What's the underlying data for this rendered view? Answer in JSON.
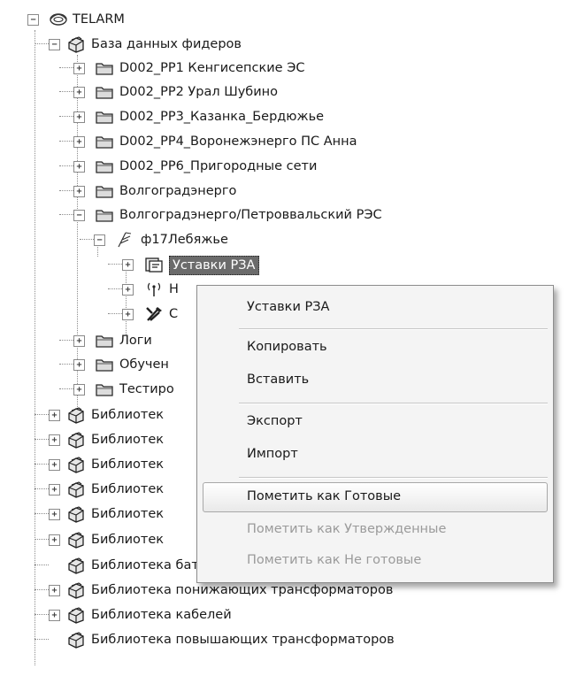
{
  "tree": {
    "root": {
      "label": "TELARM",
      "icon": "telarm-logo-icon",
      "expanded": true
    },
    "items": [
      {
        "label": "База данных фидеров",
        "icon": "database-icon",
        "expanded": true
      },
      {
        "label": "D002_PP1 Кенгисепские ЭС",
        "icon": "folder-icon",
        "expanded": false
      },
      {
        "label": "D002_PP2 Урал  Шубино",
        "icon": "folder-icon",
        "expanded": false
      },
      {
        "label": "D002_PP3_Казанка_Бердюжье",
        "icon": "folder-icon",
        "expanded": false
      },
      {
        "label": "D002_PP4_Воронежэнерго ПС Анна",
        "icon": "folder-icon",
        "expanded": false
      },
      {
        "label": "D002_PP6_Пригородные сети",
        "icon": "folder-icon",
        "expanded": false
      },
      {
        "label": "Волгоградэнерго",
        "icon": "folder-icon",
        "expanded": false
      },
      {
        "label": "Волгоградэнерго/Петроввальский РЭС",
        "icon": "folder-icon",
        "expanded": true
      },
      {
        "label": "ф17Лебяжье",
        "icon": "power-line-icon",
        "expanded": true
      },
      {
        "label": "Уставки РЗА",
        "icon": "relay-settings-icon",
        "expanded": false,
        "selected": true
      },
      {
        "label": "Н",
        "icon": "antenna-icon",
        "expanded": false
      },
      {
        "label": "С",
        "icon": "tools-icon",
        "expanded": false
      },
      {
        "label": "Логи",
        "icon": "folder-icon",
        "expanded": false
      },
      {
        "label": "Обучен",
        "icon": "folder-icon",
        "expanded": false
      },
      {
        "label": "Тестиро",
        "icon": "folder-icon",
        "expanded": false
      },
      {
        "label": "Библиотек",
        "icon": "database-icon",
        "expanded": false
      },
      {
        "label": "Библиотек",
        "icon": "database-icon",
        "expanded": false
      },
      {
        "label": "Библиотек",
        "icon": "database-icon",
        "expanded": false
      },
      {
        "label": "Библиотек",
        "icon": "database-icon",
        "expanded": false
      },
      {
        "label": "Библиотек",
        "icon": "database-icon",
        "expanded": false
      },
      {
        "label": "Библиотек",
        "icon": "database-icon",
        "expanded": false
      },
      {
        "label": "Библиотека батарей конденсаторов",
        "icon": "database-icon",
        "expanded": null
      },
      {
        "label": "Библиотека понижающих трансформаторов",
        "icon": "database-icon",
        "expanded": false
      },
      {
        "label": "Библиотека кабелей",
        "icon": "database-icon",
        "expanded": false
      },
      {
        "label": "Библиотека повышающих трансформаторов",
        "icon": "database-icon",
        "expanded": null
      }
    ]
  },
  "context_menu": {
    "header": "Уставки РЗА",
    "items": {
      "copy": "Копировать",
      "paste": "Вставить",
      "export": "Экспорт",
      "import": "Импорт",
      "mark_ready": "Пометить как Готовые",
      "mark_approved": "Пометить как Утвержденные",
      "mark_not_ready": "Пометить как Не готовые"
    },
    "hovered": "mark_ready",
    "disabled": [
      "mark_approved",
      "mark_not_ready"
    ]
  }
}
